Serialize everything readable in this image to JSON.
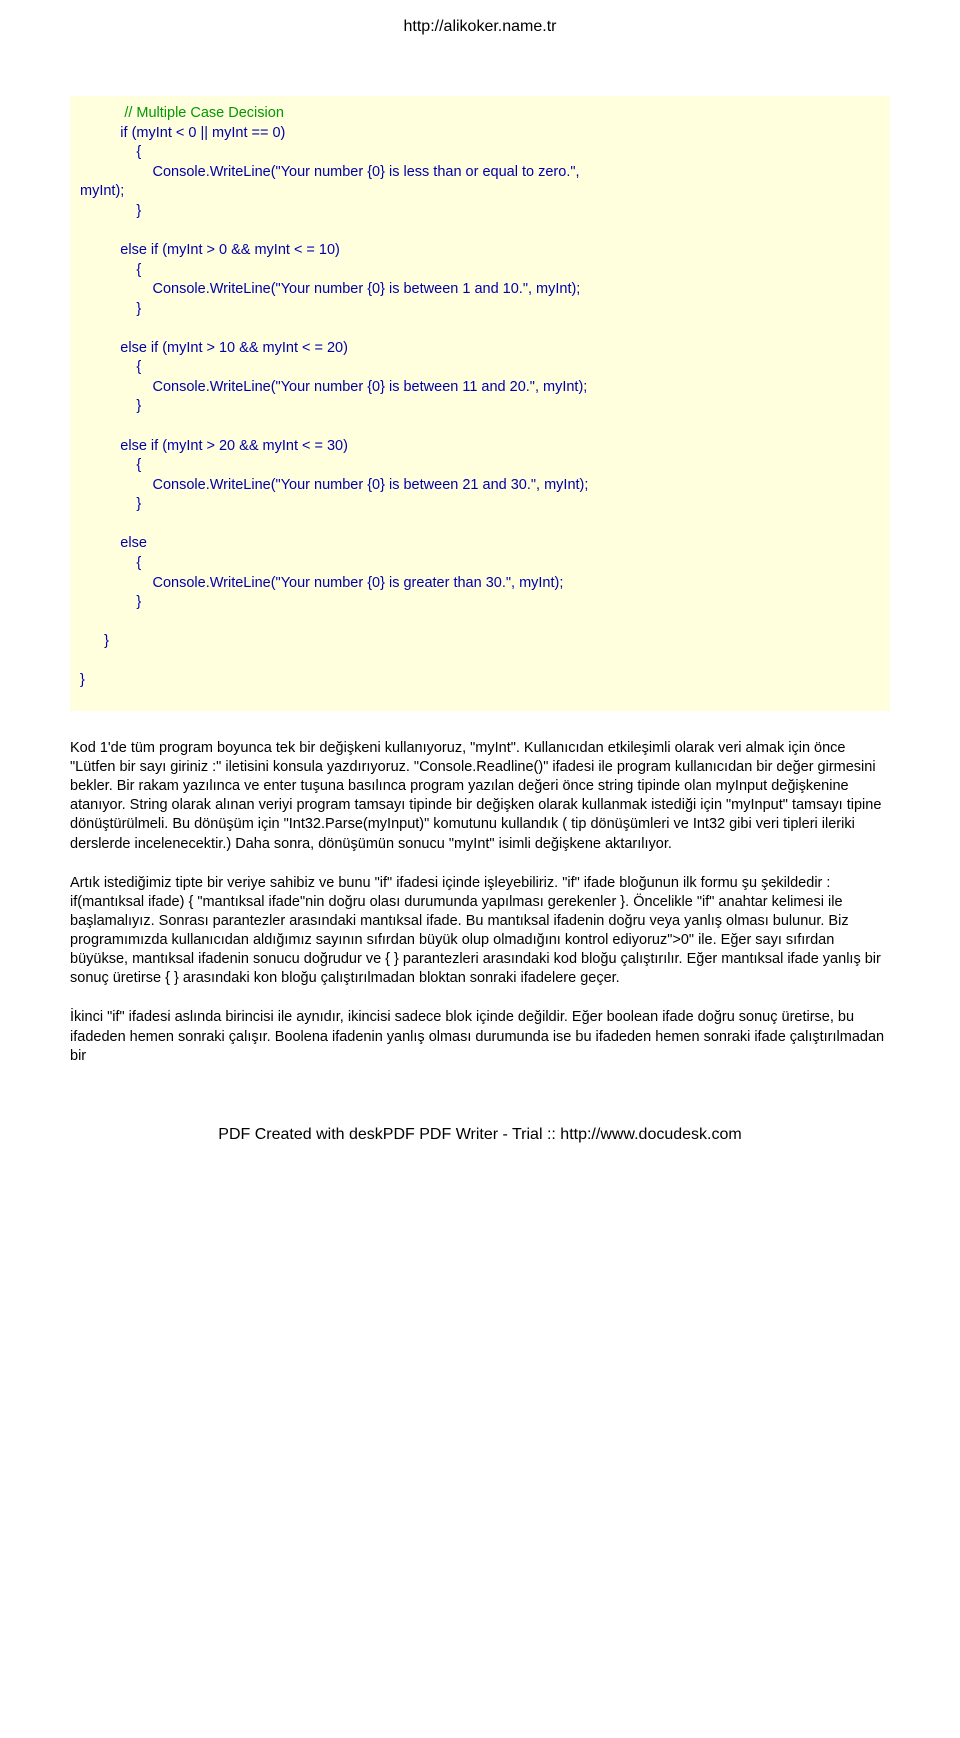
{
  "header": {
    "url": "http://alikoker.name.tr"
  },
  "code": {
    "comment_line": "           // Multiple Case Decision",
    "lines": [
      "          if (myInt < 0 || myInt == 0)",
      "              {",
      "                  Console.WriteLine(\"Your number {0} is less than or equal to zero.\",",
      "myInt);",
      "              }",
      "",
      "          else if (myInt > 0 && myInt < = 10)",
      "              {",
      "                  Console.WriteLine(\"Your number {0} is between 1 and 10.\", myInt);",
      "              }",
      "",
      "          else if (myInt > 10 && myInt < = 20)",
      "              {",
      "                  Console.WriteLine(\"Your number {0} is between 11 and 20.\", myInt);",
      "              }",
      "",
      "          else if (myInt > 20 && myInt < = 30)",
      "              {",
      "                  Console.WriteLine(\"Your number {0} is between 21 and 30.\", myInt);",
      "              }",
      "",
      "          else",
      "              {",
      "                  Console.WriteLine(\"Your number {0} is greater than 30.\", myInt);",
      "              }",
      "",
      "      }",
      "",
      "}"
    ]
  },
  "paragraphs": {
    "p1": "Kod 1'de tüm program boyunca tek bir değişkeni kullanıyoruz, \"myInt\". Kullanıcıdan etkileşimli olarak veri almak için önce \"Lütfen bir sayı giriniz :\" iletisini konsula yazdırıyoruz. \"Console.Readline()\" ifadesi ile program kullanıcıdan bir değer girmesini bekler. Bir rakam yazılınca ve enter tuşuna basılınca program yazılan değeri önce string tipinde olan myInput değişkenine atanıyor. String olarak alınan veriyi program tamsayı tipinde bir değişken olarak kullanmak istediği için \"myInput\" tamsayı tipine dönüştürülmeli. Bu dönüşüm için \"Int32.Parse(myInput)\" komutunu kullandık ( tip dönüşümleri ve Int32 gibi veri tipleri ileriki derslerde incelenecektir.) Daha sonra, dönüşümün sonucu \"myInt\" isimli değişkene aktarılıyor.",
    "p2": "Artık istediğimiz tipte bir veriye sahibiz ve bunu \"if\" ifadesi içinde işleyebiliriz. \"if\" ifade bloğunun ilk formu şu şekildedir : if(mantıksal ifade) { \"mantıksal ifade\"nin doğru olası durumunda yapılması gerekenler }. Öncelikle \"if\" anahtar kelimesi ile başlamalıyız. Sonrası parantezler arasındaki mantıksal ifade. Bu mantıksal ifadenin doğru veya yanlış olması bulunur. Biz programımızda kullanıcıdan aldığımız sayının sıfırdan büyük olup olmadığını kontrol ediyoruz\">0\" ile. Eğer sayı sıfırdan büyükse, mantıksal ifadenin sonucu doğrudur ve { } parantezleri arasındaki kod bloğu çalıştırılır. Eğer mantıksal ifade yanlış bir sonuç üretirse { } arasındaki kon bloğu çalıştırılmadan bloktan sonraki ifadelere geçer.",
    "p3": "İkinci \"if\" ifadesi aslında birincisi ile aynıdır, ikincisi sadece blok içinde değildir. Eğer boolean ifade doğru sonuç üretirse, bu ifadeden hemen sonraki çalışır. Boolena ifadenin yanlış olması durumunda ise bu ifadeden hemen sonraki ifade çalıştırılmadan bir"
  },
  "footer": {
    "text": "PDF Created with deskPDF PDF Writer - Trial :: http://www.docudesk.com"
  }
}
